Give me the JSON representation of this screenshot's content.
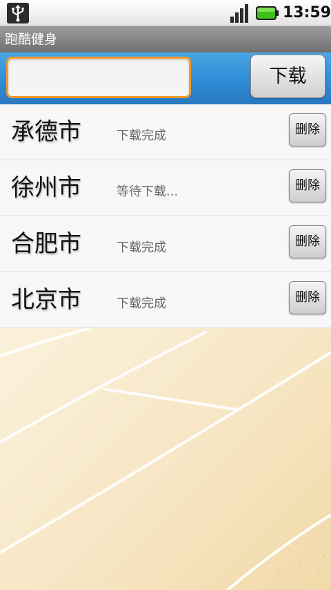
{
  "status_bar": {
    "time": "13:59",
    "icons": [
      "usb-icon",
      "signal-icon",
      "battery-icon"
    ],
    "battery_color": "#3fbf1a"
  },
  "title_bar": {
    "title": "跑酷健身"
  },
  "search": {
    "value": "",
    "placeholder": "",
    "button_label": "下载"
  },
  "cities": [
    {
      "name": "承德市",
      "status": "下载完成",
      "delete_label": "删除"
    },
    {
      "name": "徐州市",
      "status": "等待下载...",
      "delete_label": "删除"
    },
    {
      "name": "合肥市",
      "status": "下载完成",
      "delete_label": "删除"
    },
    {
      "name": "北京市",
      "status": "下载完成",
      "delete_label": "删除"
    }
  ],
  "colors": {
    "accent_blue": "#2f8fd6",
    "input_focus_border": "#f39a2a",
    "title_bar": "#8a8a8a"
  }
}
